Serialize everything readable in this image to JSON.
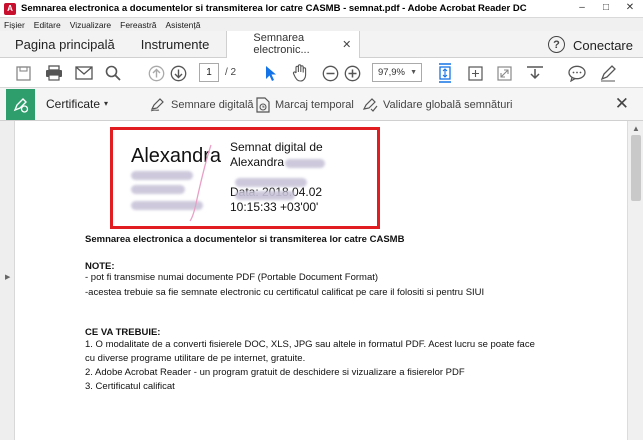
{
  "window": {
    "title": "Semnarea electronica a documentelor si transmiterea lor catre CASMB - semnat.pdf - Adobe Acrobat Reader DC",
    "controls": {
      "minimize": "–",
      "maximize": "□",
      "close": "✕"
    }
  },
  "menu": [
    "Fișier",
    "Editare",
    "Vizualizare",
    "Fereastră",
    "Asistență"
  ],
  "tabs": {
    "home": "Pagina principală",
    "tools": "Instrumente",
    "document": "Semnarea electronic...",
    "document_close": "✕",
    "help": "?",
    "login": "Conectare"
  },
  "toolbar": {
    "page_current": "1",
    "page_total": "/ 2",
    "zoom": "97,9%"
  },
  "certificates_bar": {
    "title": "Certificate",
    "caret": "▾",
    "sign": "Semnare digitală",
    "timestamp": "Marcaj temporal",
    "validate": "Validare globală semnături",
    "close": "✕"
  },
  "signature": {
    "name": "Alexandra",
    "line1": "Semnat digital de",
    "line2": "Alexandra",
    "line3": "Data: 2018.04.02",
    "line4": "10:15:33 +03'00'"
  },
  "document": {
    "heading": "Semnarea electronica a documentelor si transmiterea lor catre CASMB",
    "note_title": "NOTE:",
    "note_1": "- pot fi transmise numai documente PDF (Portable Document Format)",
    "note_2": " -acestea trebuie sa fie semnate electronic cu certificatul calificat pe care il folositi si pentru SIUI",
    "req_title": "CE VA TREBUIE:",
    "req_1a": "1. O modalitate de a converti fisierele DOC, XLS, JPG sau altele in formatul PDF. Acest lucru se poate face",
    "req_1b": "cu diverse programe utilitare de pe internet, gratuite.",
    "req_2": "2. Adobe Acrobat Reader - un program gratuit de deschidere si vizualizare a fisierelor PDF",
    "req_3": "3. Certificatul calificat"
  },
  "colors": {
    "highlight": "#e11d22",
    "cert_green": "#2e9e6c",
    "accent_blue": "#1473e6"
  }
}
